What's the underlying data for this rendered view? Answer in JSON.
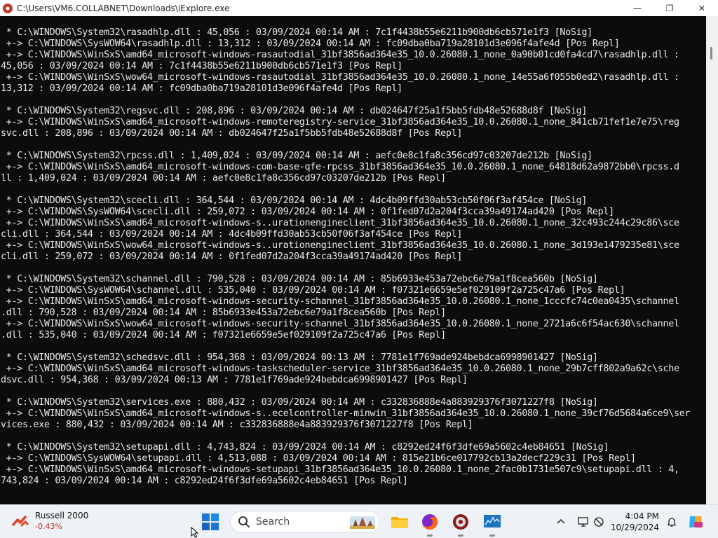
{
  "window": {
    "title": "C:\\Users\\VM6.COLLABNET\\Downloads\\iExplore.exe",
    "minimize_glyph": "—",
    "maximize_glyph": "❐",
    "close_glyph": "✕"
  },
  "console": {
    "lines": [
      " * C:\\WINDOWS\\System32\\rasadhlp.dll : 45,056 : 03/09/2024 00:14 AM : 7c1f4438b55e6211b900db6cb571e1f3 [NoSig]",
      " +-> C:\\WINDOWS\\SysWOW64\\rasadhlp.dll : 13,312 : 03/09/2024 00:14 AM : fc09dba0ba719a28101d3e096f4afe4d [Pos Repl]",
      " +-> C:\\WINDOWS\\WinSxS\\amd64_microsoft-windows-rasautodial_31bf3856ad364e35_10.0.26080.1_none_0a90b01cd0fa4cd7\\rasadhlp.dll :",
      "45,056 : 03/09/2024 00:14 AM : 7c1f4438b55e6211b900db6cb571e1f3 [Pos Repl]",
      " +-> C:\\WINDOWS\\WinSxS\\wow64_microsoft-windows-rasautodial_31bf3856ad364e35_10.0.26080.1_none_14e55a6f055b0ed2\\rasadhlp.dll :",
      "13,312 : 03/09/2024 00:14 AM : fc09dba0ba719a28101d3e096f4afe4d [Pos Repl]",
      "",
      " * C:\\WINDOWS\\System32\\regsvc.dll : 208,896 : 03/09/2024 00:14 AM : db024647f25a1f5bb5fdb48e52688d8f [NoSig]",
      " +-> C:\\WINDOWS\\WinSxS\\amd64_microsoft-windows-remoteregistry-service_31bf3856ad364e35_10.0.26080.1_none_841cb71fef1e7e75\\reg",
      "svc.dll : 208,896 : 03/09/2024 00:14 AM : db024647f25a1f5bb5fdb48e52688d8f [Pos Repl]",
      "",
      " * C:\\WINDOWS\\System32\\rpcss.dll : 1,409,024 : 03/09/2024 00:14 AM : aefc0e8c1fa8c356cd97c03207de212b [NoSig]",
      " +-> C:\\WINDOWS\\WinSxS\\amd64_microsoft-windows-com-base-qfe-rpcss_31bf3856ad364e35_10.0.26080.1_none_64818d62a9872bb0\\rpcss.d",
      "ll : 1,409,024 : 03/09/2024 00:14 AM : aefc0e8c1fa8c356cd97c03207de212b [Pos Repl]",
      "",
      " * C:\\WINDOWS\\System32\\scecli.dll : 364,544 : 03/09/2024 00:14 AM : 4dc4b09ffd30ab53cb50f06f3af454ce [NoSig]",
      " +-> C:\\WINDOWS\\SysWOW64\\scecli.dll : 259,072 : 03/09/2024 00:14 AM : 0f1fed07d2a204f3cca39a49174ad420 [Pos Repl]",
      " +-> C:\\WINDOWS\\WinSxS\\amd64_microsoft-windows-s..urationengineclient_31bf3856ad364e35_10.0.26080.1_none_32c493c244c29c86\\sce",
      "cli.dll : 364,544 : 03/09/2024 00:14 AM : 4dc4b09ffd30ab53cb50f06f3af454ce [Pos Repl]",
      " +-> C:\\WINDOWS\\WinSxS\\wow64_microsoft-windows-s..urationengineclient_31bf3856ad364e35_10.0.26080.1_none_3d193e1479235e81\\sce",
      "cli.dll : 259,072 : 03/09/2024 00:14 AM : 0f1fed07d2a204f3cca39a49174ad420 [Pos Repl]",
      "",
      " * C:\\WINDOWS\\System32\\schannel.dll : 790,528 : 03/09/2024 00:14 AM : 85b6933e453a72ebc6e79a1f8cea560b [NoSig]",
      " +-> C:\\WINDOWS\\SysWOW64\\schannel.dll : 535,040 : 03/09/2024 00:14 AM : f07321e6659e5ef029109f2a725c47a6 [Pos Repl]",
      " +-> C:\\WINDOWS\\WinSxS\\amd64_microsoft-windows-security-schannel_31bf3856ad364e35_10.0.26080.1_none_1cccfc74c0ea0435\\schannel",
      ".dll : 790,528 : 03/09/2024 00:14 AM : 85b6933e453a72ebc6e79a1f8cea560b [Pos Repl]",
      " +-> C:\\WINDOWS\\WinSxS\\wow64_microsoft-windows-security-schannel_31bf3856ad364e35_10.0.26080.1_none_2721a6c6f54ac630\\schannel",
      ".dll : 535,040 : 03/09/2024 00:14 AM : f07321e6659e5ef029109f2a725c47a6 [Pos Repl]",
      "",
      " * C:\\WINDOWS\\System32\\schedsvc.dll : 954,368 : 03/09/2024 00:13 AM : 7781e1f769ade924bebdca6998901427 [NoSig]",
      " +-> C:\\WINDOWS\\WinSxS\\amd64_microsoft-windows-taskscheduler-service_31bf3856ad364e35_10.0.26080.1_none_29b7cff802a9a62c\\sche",
      "dsvc.dll : 954,368 : 03/09/2024 00:13 AM : 7781e1f769ade924bebdca6998901427 [Pos Repl]",
      "",
      " * C:\\WINDOWS\\System32\\services.exe : 880,432 : 03/09/2024 00:14 AM : c332836888e4a883929376f3071227f8 [NoSig]",
      " +-> C:\\WINDOWS\\WinSxS\\amd64_microsoft-windows-s..ecelcontroller-minwin_31bf3856ad364e35_10.0.26080.1_none_39cf76d5684a6ce9\\ser",
      "vices.exe : 880,432 : 03/09/2024 00:14 AM : c332836888e4a883929376f3071227f8 [Pos Repl]",
      "",
      " * C:\\WINDOWS\\System32\\setupapi.dll : 4,743,824 : 03/09/2024 00:14 AM : c8292ed24f6f3dfe69a5602c4eb84651 [NoSig]",
      " +-> C:\\WINDOWS\\SysWOW64\\setupapi.dll : 4,513,088 : 03/09/2024 00:14 AM : 815e21b6ce017792cb13a2decf229c31 [Pos Repl]",
      " +-> C:\\WINDOWS\\WinSxS\\amd64_microsoft-windows-setupapi_31bf3856ad364e35_10.0.26080.1_none_2fac0b1731e507c9\\setupapi.dll : 4,",
      "743,824 : 03/09/2024 00:14 AM : c8292ed24f6f3dfe69a5602c4eb84651 [Pos Repl]"
    ]
  },
  "taskbar": {
    "widget": {
      "title": "Russell 2000",
      "change": "-0.43%"
    },
    "search": {
      "label": "Search"
    },
    "apps": [
      "file-explorer",
      "firefox",
      "iexplore",
      "monitor-app"
    ],
    "clock": {
      "time": "4:04 PM",
      "date": "10/29/2024"
    }
  }
}
